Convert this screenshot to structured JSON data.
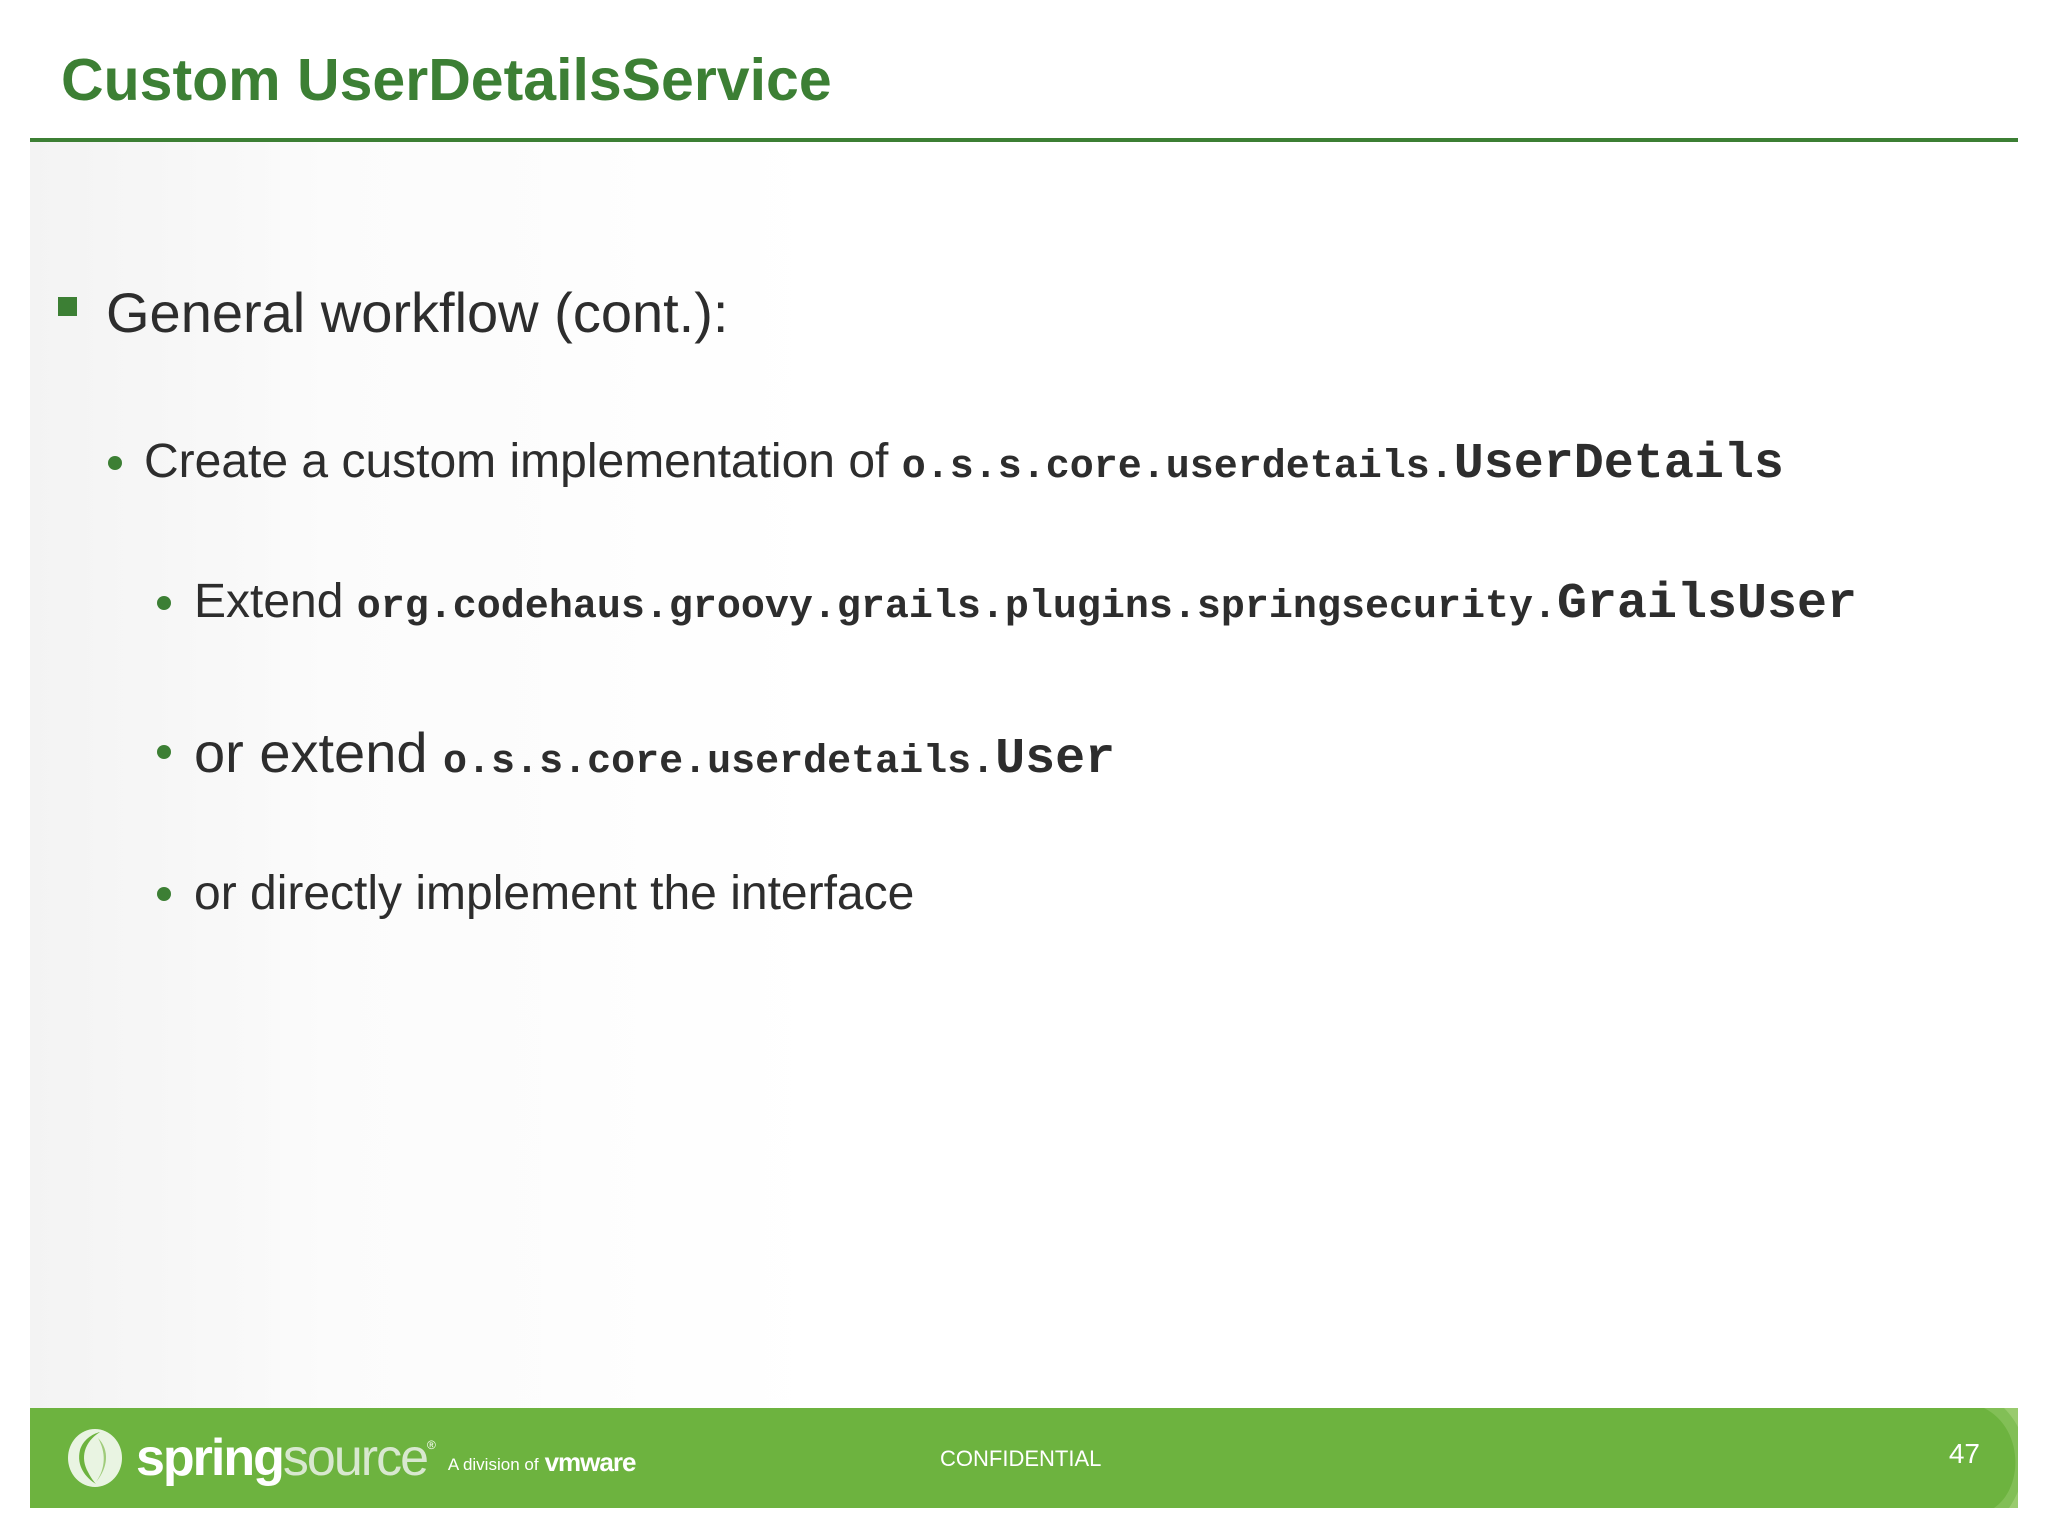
{
  "slide": {
    "title": "Custom UserDetailsService",
    "bullet_l1": "General workflow (cont.):",
    "bullets": [
      {
        "prefix": "Create a custom implementation of ",
        "code_small": "o.s.s.core.userdetails.",
        "code_big": "UserDetails"
      },
      {
        "prefix": "Extend ",
        "code_small": "org.codehaus.groovy.grails.plugins.springsecurity.",
        "code_big": "GrailsUser"
      },
      {
        "prefix": "or extend ",
        "code_small": "o.s.s.core.userdetails.",
        "code_big": "User"
      },
      {
        "text": "or directly implement the interface"
      }
    ]
  },
  "footer": {
    "logo_spring": "spring",
    "logo_source": "source",
    "logo_tm": "®",
    "logo_division": "A division of",
    "logo_vmware": "vmware",
    "confidential": "CONFIDENTIAL",
    "page_number": "47"
  },
  "colors": {
    "accent_green": "#3c7f34",
    "footer_green": "#6db33f",
    "text": "#2d2d2d"
  }
}
